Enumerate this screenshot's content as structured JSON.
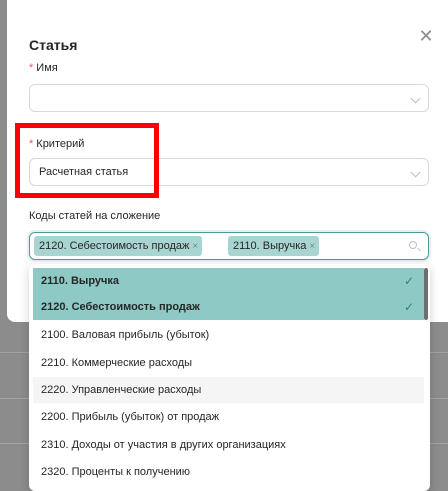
{
  "modal": {
    "title": "Статья",
    "close_icon": "close-icon"
  },
  "fields": {
    "name": {
      "label": "Имя",
      "required_mark": "*",
      "value": ""
    },
    "criterion": {
      "label": "Критерий",
      "required_mark": "*",
      "value": "Расчетная статья"
    },
    "codes": {
      "label": "Коды статей на сложение",
      "tags": [
        {
          "label": "2120. Себестоимость продаж",
          "remove": "×"
        },
        {
          "label": "2110. Выручка",
          "remove": "×"
        }
      ],
      "search_icon": "search-icon"
    }
  },
  "dropdown": {
    "options": [
      {
        "label": "2110. Выручка",
        "selected": true,
        "check": "✓"
      },
      {
        "label": "2120. Себестоимость продаж",
        "selected": true,
        "check": "✓"
      },
      {
        "label": "2100. Валовая прибыль (убыток)",
        "selected": false
      },
      {
        "label": "2210. Коммерческие расходы",
        "selected": false
      },
      {
        "label": "2220. Управленческие расходы",
        "selected": false
      },
      {
        "label": "2200. Прибыль (убыток) от продаж",
        "selected": false
      },
      {
        "label": "2310. Доходы от участия в других организациях",
        "selected": false
      },
      {
        "label": "2320. Проценты к получению",
        "selected": false
      }
    ]
  },
  "colors": {
    "accent": "#4f9a97",
    "selected_option": "#8ec9c5",
    "tag": "#a8d5d1",
    "required": "#ff4d4f",
    "annotation": "#ff0000"
  }
}
